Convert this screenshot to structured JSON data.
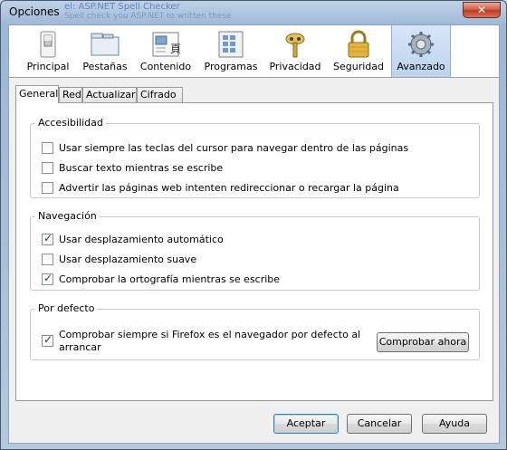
{
  "window": {
    "title": "Opciones",
    "background_text_line1": "el: ASP.NET Spell Checker",
    "background_text_line2": "Spell check you ASP.NET to written these"
  },
  "toolbar": {
    "panes": [
      {
        "label": "Principal",
        "icon": "switch-icon"
      },
      {
        "label": "Pestañas",
        "icon": "tabs-icon"
      },
      {
        "label": "Contenido",
        "icon": "content-icon"
      },
      {
        "label": "Programas",
        "icon": "applications-icon"
      },
      {
        "label": "Privacidad",
        "icon": "privacy-mask-icon"
      },
      {
        "label": "Seguridad",
        "icon": "padlock-icon"
      },
      {
        "label": "Avanzado",
        "icon": "gear-icon"
      }
    ],
    "selected": "Avanzado"
  },
  "tabs": [
    {
      "label": "General",
      "active": true
    },
    {
      "label": "Red",
      "active": false
    },
    {
      "label": "Actualizar",
      "active": false
    },
    {
      "label": "Cifrado",
      "active": false
    }
  ],
  "groups": {
    "accesibilidad": {
      "title": "Accesibilidad",
      "options": [
        {
          "label": "Usar siempre las teclas del cursor para navegar dentro de las páginas",
          "checked": false
        },
        {
          "label": "Buscar texto mientras se escribe",
          "checked": false
        },
        {
          "label": "Advertir las páginas web intenten redireccionar o recargar la página",
          "checked": false
        }
      ]
    },
    "navegacion": {
      "title": "Navegación",
      "options": [
        {
          "label": "Usar desplazamiento automático",
          "checked": true
        },
        {
          "label": "Usar desplazamiento suave",
          "checked": false
        },
        {
          "label": "Comprobar la ortografía mientras se escribe",
          "checked": true
        }
      ]
    },
    "por_defecto": {
      "title": "Por defecto",
      "option_line1": "Comprobar siempre si Firefox es el navegador por defecto al",
      "option_line2": "arrancar",
      "checked": true,
      "button": "Comprobar ahora"
    }
  },
  "buttons": {
    "accept": "Aceptar",
    "cancel": "Cancelar",
    "help": "Ayuda"
  },
  "colors": {
    "titlebar": "#a9c1dc",
    "close_button": "#c0391f",
    "selected_pane": "#bcd3ec",
    "default_button_border": "#3c7fb1"
  }
}
